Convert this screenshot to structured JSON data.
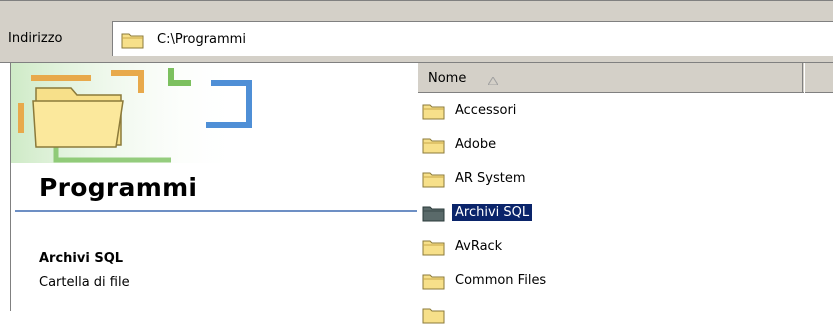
{
  "address": {
    "label": "Indirizzo",
    "path": "C:\\Programmi"
  },
  "left_pane": {
    "title": "Programmi",
    "selected_name": "Archivi SQL",
    "selected_type": "Cartella di file"
  },
  "columns": {
    "name": "Nome",
    "sort_indicator": "ascending"
  },
  "files": [
    {
      "name": "Accessori",
      "icon": "folder-icon"
    },
    {
      "name": "Adobe",
      "icon": "folder-icon"
    },
    {
      "name": "AR System",
      "icon": "folder-icon"
    },
    {
      "name": "Archivi SQL",
      "icon": "folder-icon",
      "selected": true
    },
    {
      "name": "AvRack",
      "icon": "folder-icon"
    },
    {
      "name": "Common Files",
      "icon": "folder-icon"
    }
  ],
  "colors": {
    "selection": "#0a246a",
    "chrome": "#d4d0c8",
    "banner_line": "#6d8fc4"
  }
}
